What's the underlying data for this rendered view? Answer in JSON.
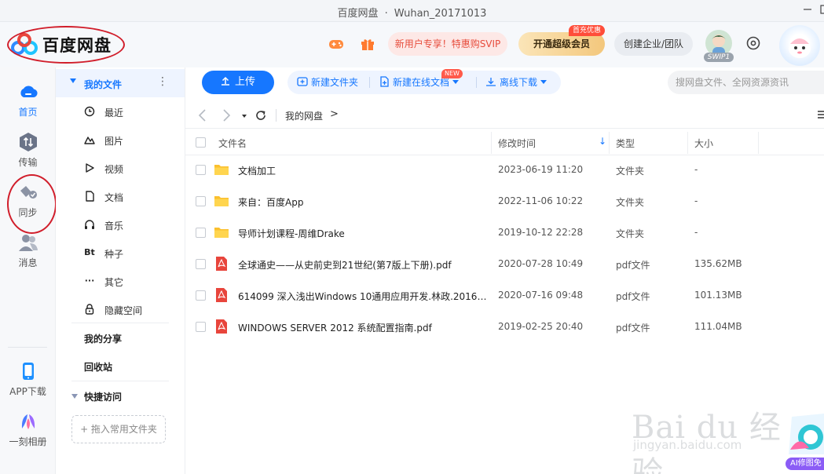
{
  "window": {
    "app_name": "百度网盘",
    "separator": "·",
    "account": "Wuhan_20171013"
  },
  "header": {
    "logo_text": "百度网盘",
    "promo_label": "新用户专享！特惠购SVIP",
    "vip_label": "开通超级会员",
    "vip_tag": "首充优惠",
    "enterprise_label": "创建企业/团队",
    "svip_tag": "SWIP1"
  },
  "leftnav": {
    "items": [
      {
        "label": "首页"
      },
      {
        "label": "传输"
      },
      {
        "label": "同步"
      },
      {
        "label": "消息"
      },
      {
        "label": "APP下载"
      },
      {
        "label": "一刻相册"
      }
    ]
  },
  "sidebar": {
    "section_title": "我的文件",
    "more": "⋮",
    "items": [
      {
        "label": "最近"
      },
      {
        "label": "图片"
      },
      {
        "label": "视频"
      },
      {
        "label": "文档"
      },
      {
        "label": "音乐"
      },
      {
        "label": "种子",
        "icon_text": "Bt"
      },
      {
        "label": "其它",
        "icon_text": "···"
      },
      {
        "label": "隐藏空间"
      }
    ],
    "my_share": "我的分享",
    "recycle_bin": "回收站",
    "quick_access": "快捷访问",
    "drop_hint": "+ 拖入常用文件夹"
  },
  "toolbar": {
    "upload_label": "上传",
    "new_folder_label": "新建文件夹",
    "new_online_doc_label": "新建在线文档",
    "new_badge": "NEW",
    "offline_download_label": "离线下载",
    "search_placeholder": "搜网盘文件、全网资源资讯"
  },
  "breadcrumb": {
    "root": "我的网盘",
    "arrow": ">"
  },
  "table": {
    "headers": {
      "name": "文件名",
      "modified": "修改时间",
      "type": "类型",
      "size": "大小"
    },
    "sort_indicator": "↓",
    "rows": [
      {
        "name": "文档加工",
        "modified": "2023-06-19 11:20",
        "type": "文件夹",
        "size": "-",
        "kind": "folder"
      },
      {
        "name": "来自：百度App",
        "modified": "2022-11-06 10:22",
        "type": "文件夹",
        "size": "-",
        "kind": "folder"
      },
      {
        "name": "导师计划课程-周维Drake",
        "modified": "2019-10-12 22:28",
        "type": "文件夹",
        "size": "-",
        "kind": "folder"
      },
      {
        "name": "全球通史——从史前史到21世纪(第7版上下册).pdf",
        "modified": "2020-07-28 10:49",
        "type": "pdf文件",
        "size": "135.62MB",
        "kind": "pdf"
      },
      {
        "name": "614099 深入浅出Windows 10通用应用开发.林政.2016.…",
        "modified": "2020-07-16 09:48",
        "type": "pdf文件",
        "size": "101.13MB",
        "kind": "pdf"
      },
      {
        "name": "WINDOWS SERVER 2012 系统配置指南.pdf",
        "modified": "2019-02-25 20:40",
        "type": "pdf文件",
        "size": "111.04MB",
        "kind": "pdf"
      }
    ]
  },
  "watermark": {
    "main": "Bai du 经验",
    "sub": "jingyan.baidu.com",
    "ai_label": "AI修图免"
  },
  "colors": {
    "accent": "#1677ff",
    "annotation_red": "#d11e2b",
    "folder": "#fbc02d",
    "pdf": "#e8453c"
  }
}
